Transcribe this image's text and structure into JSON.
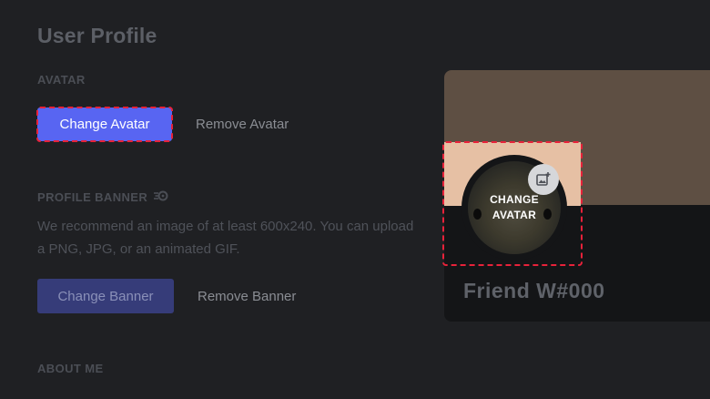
{
  "header": {
    "title": "User Profile"
  },
  "avatar_section": {
    "label": "AVATAR",
    "change_label": "Change Avatar",
    "remove_label": "Remove Avatar"
  },
  "banner_section": {
    "label": "PROFILE BANNER",
    "description": "We recommend an image of at least 600x240. You can upload a PNG, JPG, or an animated GIF.",
    "change_label": "Change Banner",
    "remove_label": "Remove Banner"
  },
  "about_section": {
    "label": "ABOUT ME"
  },
  "preview": {
    "avatar_overlay_line1": "CHANGE",
    "avatar_overlay_line2": "AVATAR",
    "username": "Friend W#000",
    "banner_color": "#5e4f43",
    "card_background": "#141517"
  },
  "colors": {
    "accent": "#5865f2",
    "highlight": "#e8223a"
  },
  "icons": {
    "nitro": "nitro-icon",
    "add_image": "add-image-icon"
  }
}
